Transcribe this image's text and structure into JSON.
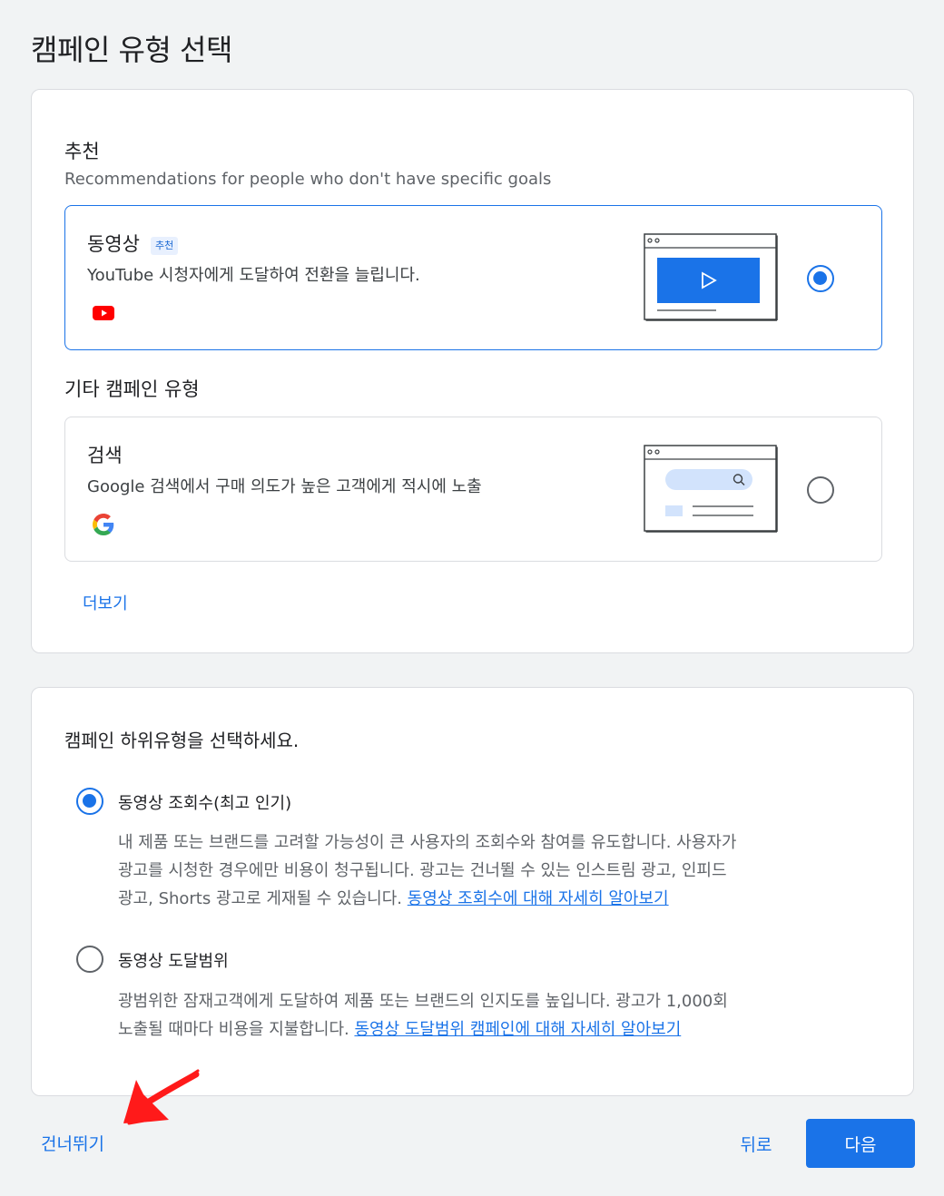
{
  "page": {
    "title": "캠페인 유형 선택"
  },
  "recommended": {
    "heading": "추천",
    "subtitle": "Recommendations for people who don't have specific goals",
    "card": {
      "title": "동영상",
      "badge": "추천",
      "description": "YouTube 시청자에게 도달하여 전환을 늘립니다.",
      "brand_icon": "youtube-logo-icon",
      "selected": true
    }
  },
  "other": {
    "heading": "기타 캠페인 유형",
    "card": {
      "title": "검색",
      "description": "Google 검색에서 구매 의도가 높은 고객에게 적시에 노출",
      "brand_icon": "google-logo-icon",
      "selected": false
    },
    "more_label": "더보기"
  },
  "subtype": {
    "heading": "캠페인 하위유형을 선택하세요.",
    "options": [
      {
        "label": "동영상 조회수(최고 인기)",
        "desc_lines": [
          "내 제품 또는 브랜드를 고려할 가능성이 큰 사용자의 조회수와 참여를 유도합니다. 사용자가",
          "광고를 시청한 경우에만 비용이 청구됩니다. 광고는 건너뛸 수 있는 인스트림 광고, 인피드",
          "광고, Shorts 광고로 게재될 수 있습니다. "
        ],
        "link": "동영상 조회수에 대해 자세히 알아보기",
        "selected": true
      },
      {
        "label": "동영상 도달범위",
        "desc_lines": [
          "광범위한 잠재고객에게 도달하여 제품 또는 브랜드의 인지도를 높입니다. 광고가 1,000회",
          "노출될 때마다 비용을 지불합니다. "
        ],
        "link": "동영상 도달범위 캠페인에 대해 자세히 알아보기",
        "selected": false
      }
    ]
  },
  "footer": {
    "skip_label": "건너뛰기",
    "back_label": "뒤로",
    "next_label": "다음"
  },
  "colors": {
    "accent": "#1a73e8",
    "annotation": "#ff1a1a",
    "youtube_red": "#ff0000"
  }
}
